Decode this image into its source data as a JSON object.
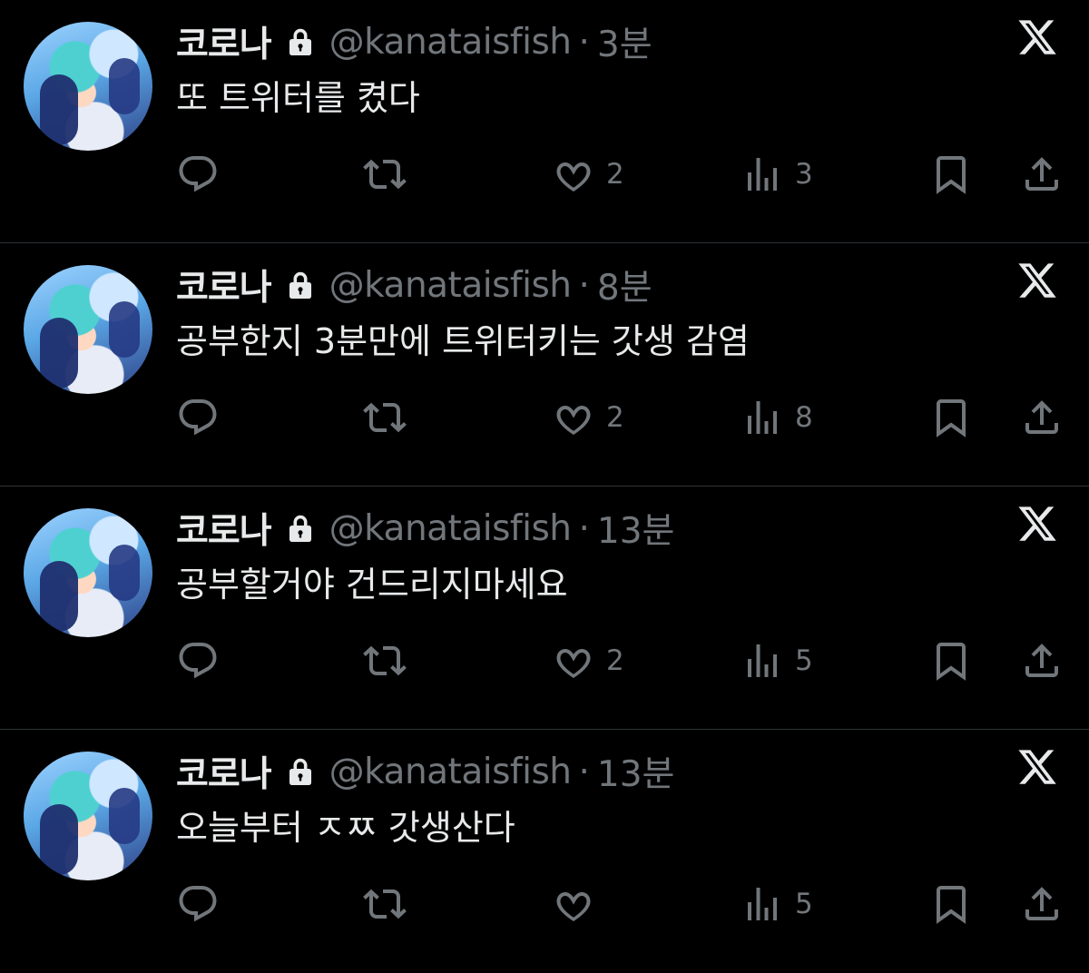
{
  "tweets": [
    {
      "display_name": "코로나",
      "handle": "@kanataisfish",
      "time": "3분",
      "text": "또 트위터를 켰다",
      "likes": "2",
      "views": "3"
    },
    {
      "display_name": "코로나",
      "handle": "@kanataisfish",
      "time": "8분",
      "text": "공부한지 3분만에 트위터키는 갓생 감염",
      "likes": "2",
      "views": "8"
    },
    {
      "display_name": "코로나",
      "handle": "@kanataisfish",
      "time": "13분",
      "text": "공부할거야 건드리지마세요",
      "likes": "2",
      "views": "5"
    },
    {
      "display_name": "코로나",
      "handle": "@kanataisfish",
      "time": "13분",
      "text": "오늘부터 ㅈㅉ 갓생산다",
      "likes": "",
      "views": "5"
    }
  ],
  "separator": "·",
  "icons": {
    "lock": "lock-icon",
    "more": "x-logo-icon",
    "reply": "reply-icon",
    "retweet": "retweet-icon",
    "like": "heart-icon",
    "views": "views-icon",
    "bookmark": "bookmark-icon",
    "share": "share-icon"
  },
  "colors": {
    "background": "#000000",
    "primary_text": "#e7e9ea",
    "secondary_text": "#71767b",
    "divider": "#2f3336"
  }
}
